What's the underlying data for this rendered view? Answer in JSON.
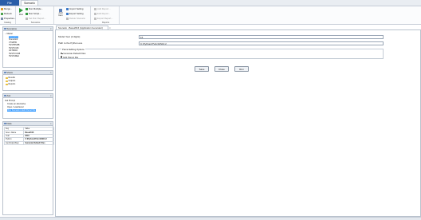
{
  "ribbon_tabs": {
    "file": "File",
    "scenario": "Scenario"
  },
  "ribbon": {
    "catalog": {
      "label": "Catalog",
      "items": [
        "Merge...",
        "Refresh",
        "Properties..."
      ]
    },
    "scenarios": {
      "label": "Scenarios",
      "run": "Run",
      "items": [
        "Run Multiple...",
        "Run Script...",
        "Set Run Report..."
      ]
    },
    "add_item": "Add Item",
    "setting": {
      "items": [
        "Import Setting",
        "Export Setting",
        "Delete Scenario"
      ]
    },
    "reports": {
      "label": "Reports",
      "items": [
        "Add Report...",
        "Edit Report...",
        "Export Report..."
      ]
    }
  },
  "scenarios_panel": {
    "title": "Scenarios",
    "root": "Master",
    "items": [
      "Scenario1",
      "Scenario2",
      "VTGBH0",
      "TESTBSMB",
      "TESTU046",
      "ASTD046",
      "TESTCC048",
      "TESTAREA"
    ]
  },
  "views_panel": {
    "title": "Views",
    "items": [
      "Results",
      "Outputs",
      "Reports"
    ]
  },
  "ask_panel": {
    "title": "Ask",
    "items": [
      "Ask Prompt",
      "Create an alternative",
      "Open / Load Excel",
      "Run Scenario & Edit Parcel File"
    ]
  },
  "data_panel": {
    "title": "Data",
    "headers": [
      "Key",
      "Value"
    ],
    "rows": [
      [
        "Scen. Name",
        "Base2016"
      ],
      [
        "Year",
        "2016"
      ],
      [
        "Python",
        "C:\\Python27\\ArcGIS10.2"
      ],
      [
        "GenOutputStep",
        "Generate Default Files"
      ]
    ]
  },
  "document": {
    "tab_title": "Scenario - Base2016 (Application Generator)",
    "model_year_label": "Model Year (2 digits)",
    "model_year_value": "16",
    "python_path_label": "Path to the Python.exe",
    "python_path_value": "C:\\Python27\\ArcGIS10.2",
    "parcel_group_title": "Parcel Editing Options",
    "options": [
      "Generate Default Files",
      "Edit Parcel File"
    ],
    "buttons": {
      "save": "Save",
      "close": "Close",
      "run": "Run"
    }
  },
  "colors": {
    "accent": "#2a5ea8",
    "selection": "#3399ff",
    "panel_header": "#dfe5ec"
  }
}
